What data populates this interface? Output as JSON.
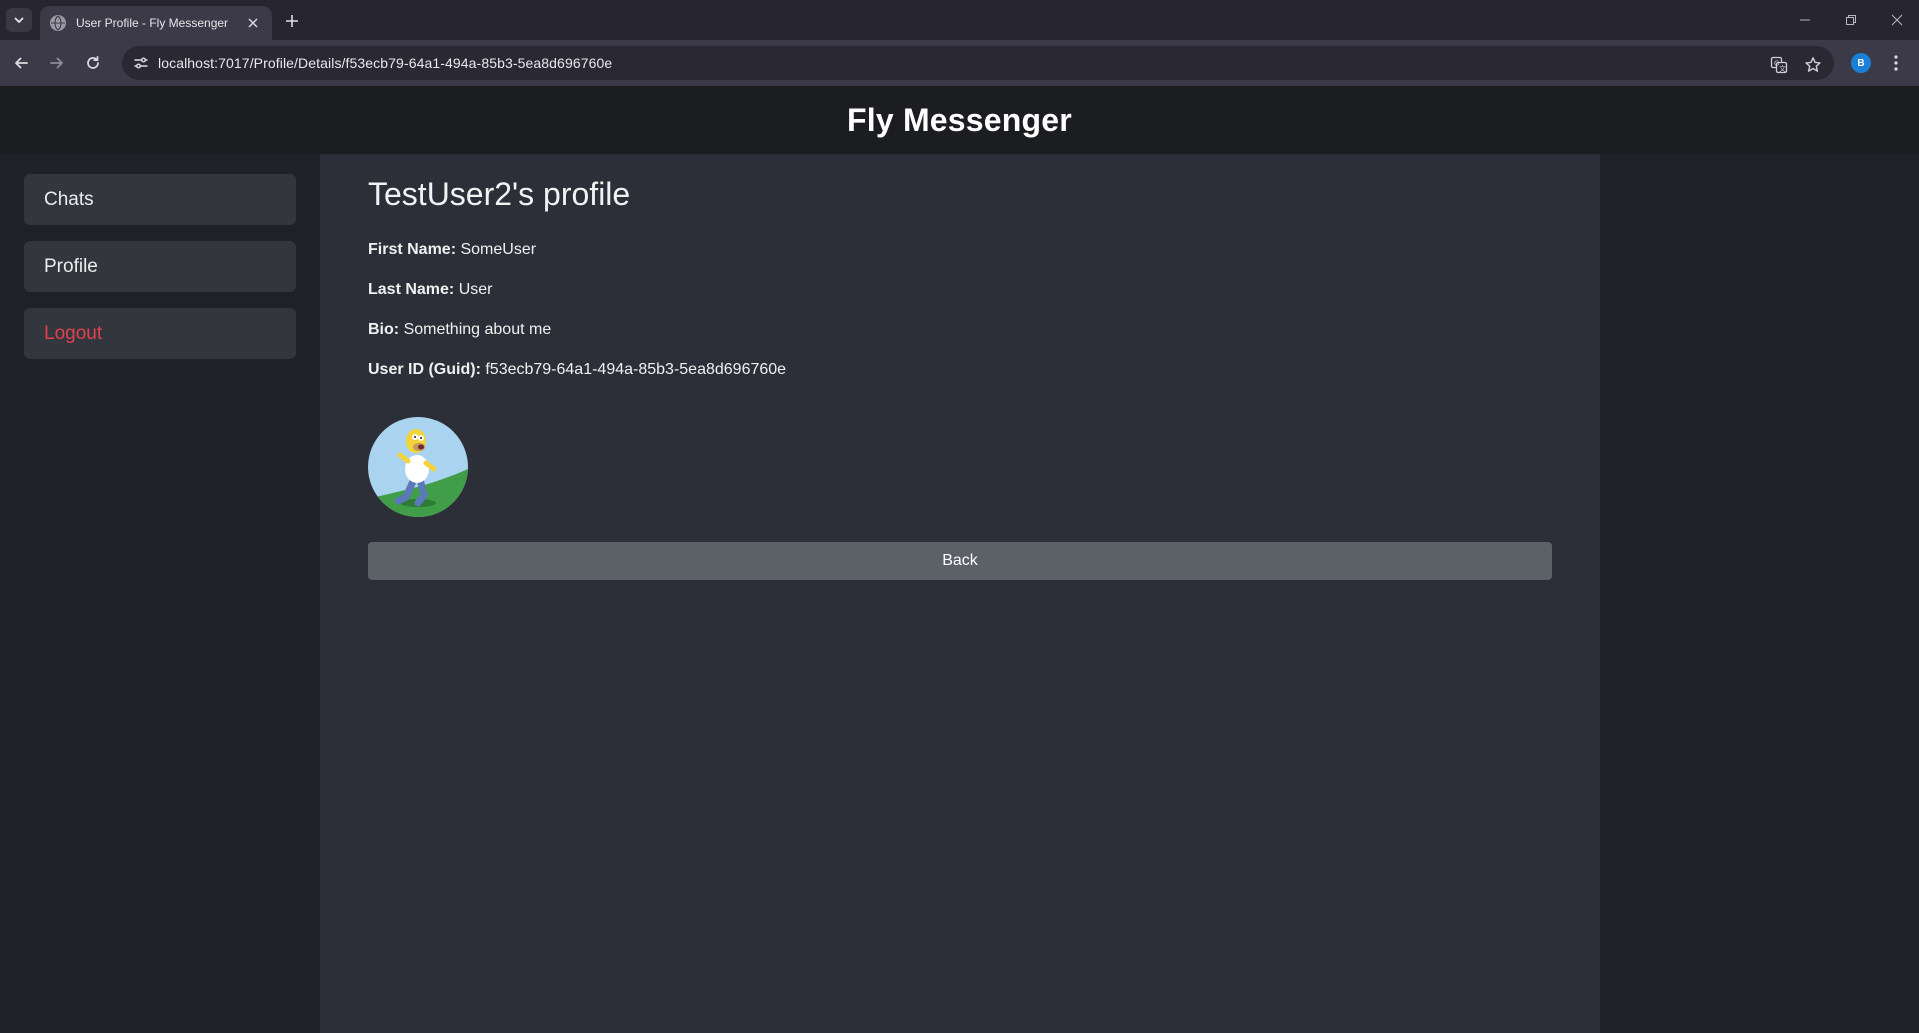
{
  "browser": {
    "tab_title": "User Profile - Fly Messenger",
    "url": "localhost:7017/Profile/Details/f53ecb79-64a1-494a-85b3-5ea8d696760e",
    "profile_initial": "B"
  },
  "app": {
    "title": "Fly Messenger"
  },
  "sidebar": {
    "items": [
      {
        "label": "Chats"
      },
      {
        "label": "Profile"
      },
      {
        "label": "Logout"
      }
    ],
    "logout_color": "#e2414f"
  },
  "profile": {
    "heading": "TestUser2's profile",
    "first_name_label": "First Name:",
    "first_name": "SomeUser",
    "last_name_label": "Last Name:",
    "last_name": "User",
    "bio_label": "Bio:",
    "bio": "Something about me",
    "user_id_label": "User ID (Guid):",
    "user_id": "f53ecb79-64a1-494a-85b3-5ea8d696760e",
    "back_label": "Back"
  },
  "icons": {
    "tab_menu": "chevron-down-icon",
    "favicon": "globe-icon",
    "back": "arrow-left-icon",
    "forward": "arrow-right-icon",
    "reload": "reload-icon",
    "site_info": "site-info-icon",
    "translate": "translate-icon",
    "bookmark": "star-icon",
    "menu": "kebab-menu-icon",
    "avatar": "cartoon-running-man-avatar"
  }
}
